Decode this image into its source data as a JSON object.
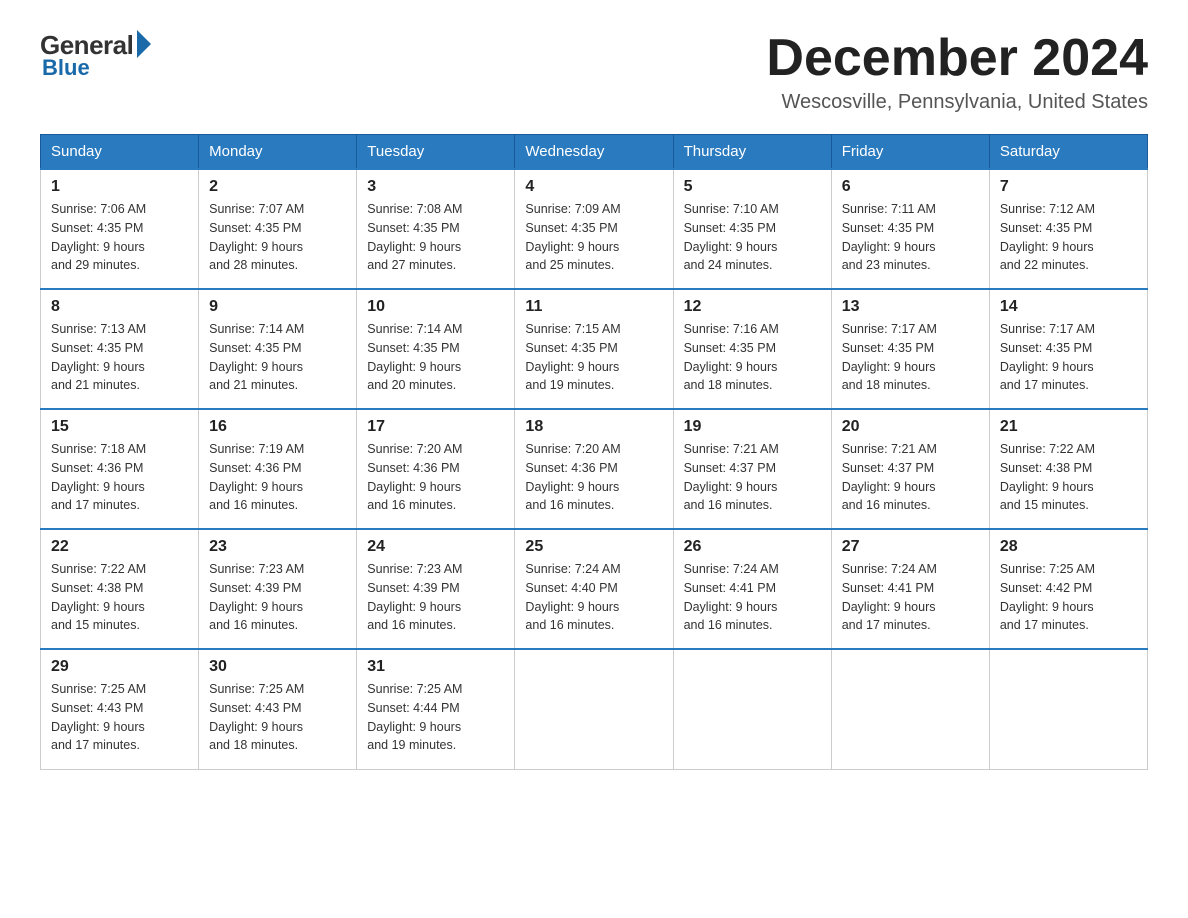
{
  "logo": {
    "general": "General",
    "blue": "Blue"
  },
  "header": {
    "month": "December 2024",
    "location": "Wescosville, Pennsylvania, United States"
  },
  "weekdays": [
    "Sunday",
    "Monday",
    "Tuesday",
    "Wednesday",
    "Thursday",
    "Friday",
    "Saturday"
  ],
  "weeks": [
    [
      {
        "day": "1",
        "sunrise": "7:06 AM",
        "sunset": "4:35 PM",
        "daylight": "9 hours and 29 minutes."
      },
      {
        "day": "2",
        "sunrise": "7:07 AM",
        "sunset": "4:35 PM",
        "daylight": "9 hours and 28 minutes."
      },
      {
        "day": "3",
        "sunrise": "7:08 AM",
        "sunset": "4:35 PM",
        "daylight": "9 hours and 27 minutes."
      },
      {
        "day": "4",
        "sunrise": "7:09 AM",
        "sunset": "4:35 PM",
        "daylight": "9 hours and 25 minutes."
      },
      {
        "day": "5",
        "sunrise": "7:10 AM",
        "sunset": "4:35 PM",
        "daylight": "9 hours and 24 minutes."
      },
      {
        "day": "6",
        "sunrise": "7:11 AM",
        "sunset": "4:35 PM",
        "daylight": "9 hours and 23 minutes."
      },
      {
        "day": "7",
        "sunrise": "7:12 AM",
        "sunset": "4:35 PM",
        "daylight": "9 hours and 22 minutes."
      }
    ],
    [
      {
        "day": "8",
        "sunrise": "7:13 AM",
        "sunset": "4:35 PM",
        "daylight": "9 hours and 21 minutes."
      },
      {
        "day": "9",
        "sunrise": "7:14 AM",
        "sunset": "4:35 PM",
        "daylight": "9 hours and 21 minutes."
      },
      {
        "day": "10",
        "sunrise": "7:14 AM",
        "sunset": "4:35 PM",
        "daylight": "9 hours and 20 minutes."
      },
      {
        "day": "11",
        "sunrise": "7:15 AM",
        "sunset": "4:35 PM",
        "daylight": "9 hours and 19 minutes."
      },
      {
        "day": "12",
        "sunrise": "7:16 AM",
        "sunset": "4:35 PM",
        "daylight": "9 hours and 18 minutes."
      },
      {
        "day": "13",
        "sunrise": "7:17 AM",
        "sunset": "4:35 PM",
        "daylight": "9 hours and 18 minutes."
      },
      {
        "day": "14",
        "sunrise": "7:17 AM",
        "sunset": "4:35 PM",
        "daylight": "9 hours and 17 minutes."
      }
    ],
    [
      {
        "day": "15",
        "sunrise": "7:18 AM",
        "sunset": "4:36 PM",
        "daylight": "9 hours and 17 minutes."
      },
      {
        "day": "16",
        "sunrise": "7:19 AM",
        "sunset": "4:36 PM",
        "daylight": "9 hours and 16 minutes."
      },
      {
        "day": "17",
        "sunrise": "7:20 AM",
        "sunset": "4:36 PM",
        "daylight": "9 hours and 16 minutes."
      },
      {
        "day": "18",
        "sunrise": "7:20 AM",
        "sunset": "4:36 PM",
        "daylight": "9 hours and 16 minutes."
      },
      {
        "day": "19",
        "sunrise": "7:21 AM",
        "sunset": "4:37 PM",
        "daylight": "9 hours and 16 minutes."
      },
      {
        "day": "20",
        "sunrise": "7:21 AM",
        "sunset": "4:37 PM",
        "daylight": "9 hours and 16 minutes."
      },
      {
        "day": "21",
        "sunrise": "7:22 AM",
        "sunset": "4:38 PM",
        "daylight": "9 hours and 15 minutes."
      }
    ],
    [
      {
        "day": "22",
        "sunrise": "7:22 AM",
        "sunset": "4:38 PM",
        "daylight": "9 hours and 15 minutes."
      },
      {
        "day": "23",
        "sunrise": "7:23 AM",
        "sunset": "4:39 PM",
        "daylight": "9 hours and 16 minutes."
      },
      {
        "day": "24",
        "sunrise": "7:23 AM",
        "sunset": "4:39 PM",
        "daylight": "9 hours and 16 minutes."
      },
      {
        "day": "25",
        "sunrise": "7:24 AM",
        "sunset": "4:40 PM",
        "daylight": "9 hours and 16 minutes."
      },
      {
        "day": "26",
        "sunrise": "7:24 AM",
        "sunset": "4:41 PM",
        "daylight": "9 hours and 16 minutes."
      },
      {
        "day": "27",
        "sunrise": "7:24 AM",
        "sunset": "4:41 PM",
        "daylight": "9 hours and 17 minutes."
      },
      {
        "day": "28",
        "sunrise": "7:25 AM",
        "sunset": "4:42 PM",
        "daylight": "9 hours and 17 minutes."
      }
    ],
    [
      {
        "day": "29",
        "sunrise": "7:25 AM",
        "sunset": "4:43 PM",
        "daylight": "9 hours and 17 minutes."
      },
      {
        "day": "30",
        "sunrise": "7:25 AM",
        "sunset": "4:43 PM",
        "daylight": "9 hours and 18 minutes."
      },
      {
        "day": "31",
        "sunrise": "7:25 AM",
        "sunset": "4:44 PM",
        "daylight": "9 hours and 19 minutes."
      },
      null,
      null,
      null,
      null
    ]
  ],
  "labels": {
    "sunrise": "Sunrise: ",
    "sunset": "Sunset: ",
    "daylight": "Daylight: "
  }
}
